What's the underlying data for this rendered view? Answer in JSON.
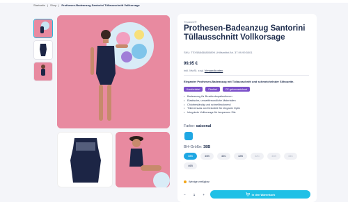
{
  "breadcrumb": {
    "home": "Startseite",
    "sep1": "|",
    "shop": "Shop",
    "sep2": "|",
    "current": "Prothesen-Badeanzug Santorini Tüllausschnitt Vollkorsage"
  },
  "product": {
    "brand": "Thuasne®",
    "title": "Prothesen-Badeanzug Santorini Tüllausschnitt Vollkorsage",
    "sku": "SKU: TSY588458800899 | Hilfsmittel-Nr. 37.99.99.5001",
    "price": "99,95 €",
    "tax_prefix": "inkl. MwSt. zzgl.",
    "tax_link": "Versandkosten",
    "description": "Eleganter Prothesen-Badeanzug mit Tüllausschnitt und schmeichelnder Silhouette.",
    "tags": [
      "Komfortabel",
      "Flexibel",
      "CE-gekennzeichnet"
    ],
    "features": [
      "Badeanzug für Brustkrebspatientinnen",
      "Elastische, umweltfreundliche Materialien",
      "Chlorbeständig und schnelltrocknend",
      "Tüllereinsatz am Dekolleté für elegante Optik",
      "Integrierte Vollkorsage für bequemen Sitz"
    ]
  },
  "color": {
    "label": "Farbe:",
    "value": "saisonal",
    "swatch": "#1fa7e3"
  },
  "size": {
    "label": "BH-Größe:",
    "value": "38B",
    "options": [
      {
        "label": "38B",
        "state": "selected"
      },
      {
        "label": "40B",
        "state": "available"
      },
      {
        "label": "40C",
        "state": "available"
      },
      {
        "label": "42B",
        "state": "available"
      },
      {
        "label": "42C",
        "state": "unavailable"
      },
      {
        "label": "44B",
        "state": "unavailable"
      },
      {
        "label": "44C",
        "state": "unavailable"
      },
      {
        "label": "46B",
        "state": "available"
      }
    ]
  },
  "stock": {
    "text": "Wenige verfügbar",
    "color": "#f2a516"
  },
  "quantity": {
    "minus": "−",
    "value": "1",
    "plus": "+"
  },
  "cart": {
    "label": "In den Warenkorb"
  }
}
